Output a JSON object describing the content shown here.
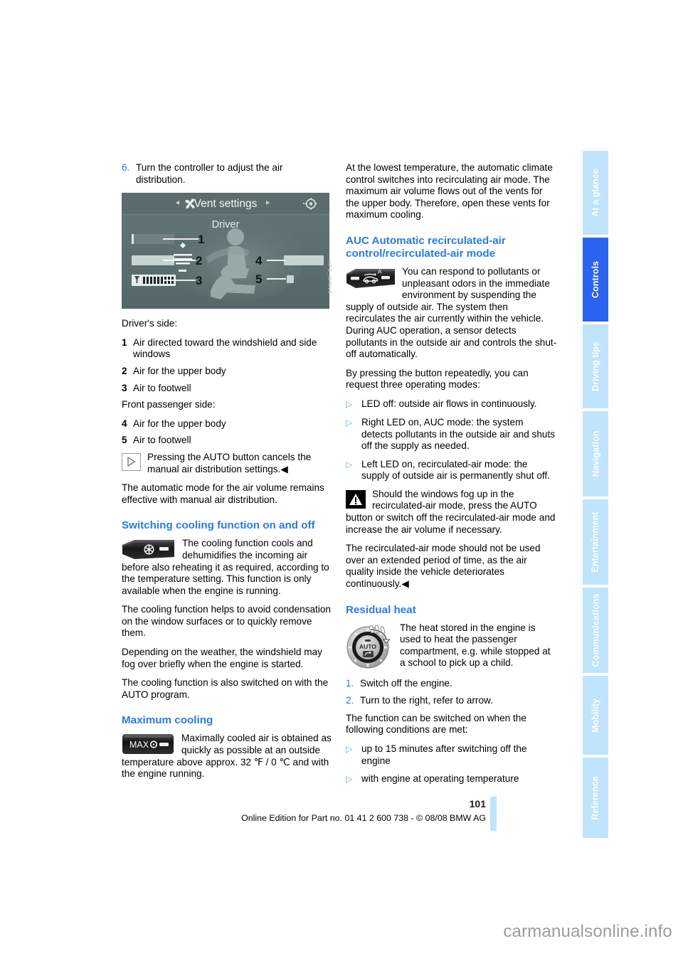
{
  "document": {
    "page_number": "101",
    "edition_line": "Online Edition for Part no. 01 41 2 600 738 - © 08/08 BMW AG",
    "watermark": "carmanualsonline.info"
  },
  "tabs": [
    {
      "label": "At a glance",
      "active": false
    },
    {
      "label": "Controls",
      "active": true
    },
    {
      "label": "Driving tips",
      "active": false
    },
    {
      "label": "Navigation",
      "active": false
    },
    {
      "label": "Entertainment",
      "active": false
    },
    {
      "label": "Communications",
      "active": false
    },
    {
      "label": "Mobility",
      "active": false
    },
    {
      "label": "Reference",
      "active": false
    }
  ],
  "colors": {
    "heading_blue": "#2a7ae4",
    "tab_inactive": "#bfe4fb",
    "tab_active": "#2a63ee",
    "bullet_blue": "#6ba8f0"
  },
  "left_column": {
    "step6": {
      "num": "6.",
      "text": "Turn the controller to adjust the air distribution."
    },
    "figure": {
      "header_title": "Vent settings",
      "subtitle": "Driver",
      "left_arrow": "◂",
      "right_arrow": "▸",
      "fan_icon": "fan-icon",
      "gear_icon": "settings-icon",
      "callout_labels": [
        "1",
        "2",
        "3",
        "4",
        "5"
      ],
      "code": "HFD_IDRIVE"
    },
    "drivers_side_label": "Driver's side:",
    "drivers_side_items": [
      {
        "num": "1",
        "text": "Air directed toward the windshield and side windows"
      },
      {
        "num": "2",
        "text": "Air for the upper body"
      },
      {
        "num": "3",
        "text": "Air to footwell"
      }
    ],
    "passenger_side_label": "Front passenger side:",
    "passenger_side_items": [
      {
        "num": "4",
        "text": "Air for the upper body"
      },
      {
        "num": "5",
        "text": "Air to footwell"
      }
    ],
    "note": "Pressing the AUTO button cancels the manual air distribution settings.◀",
    "auto_mode_para": "The automatic mode for the air volume remains effective with manual air distribution.",
    "cooling_heading": "Switching cooling function on and off",
    "cooling_para1": "The cooling function cools and dehumidifies the incoming air before also reheating it as required, according to the temperature setting. This function is only available when the engine is running.",
    "cooling_para2": "The cooling function helps to avoid condensation on the window surfaces or to quickly remove them.",
    "cooling_para3": "Depending on the weather, the windshield may fog over briefly when the engine is started.",
    "cooling_para4": "The cooling function is also switched on with the AUTO program.",
    "max_heading": "Maximum cooling",
    "max_button_label": "MAX",
    "max_para": "Maximally cooled air is obtained as quickly as possible at an outside temperature above approx. 32 ℉ / 0 ℃ and with the engine running."
  },
  "right_column": {
    "lowest_temp_para": "At the lowest temperature, the automatic climate control switches into recirculating air mode. The maximum air volume flows out of the vents for the upper body. Therefore, open these vents for maximum cooling.",
    "auc_heading": "AUC Automatic recirculated-air control/recirculated-air mode",
    "auc_button_letter": "A",
    "auc_para1": "You can respond to pollutants or unpleasant odors in the immediate environment by suspending the supply of outside air. The system then recirculates the air currently within the vehicle. During AUC operation, a sensor detects pollutants in the outside air and controls the shut-off automatically.",
    "auc_para2": "By pressing the button repeatedly, you can request three operating modes:",
    "auc_modes": [
      "LED off: outside air flows in continuously.",
      "Right LED on, AUC mode: the system detects pollutants in the outside air and shuts off the supply as needed.",
      "Left LED on, recirculated-air mode: the supply of outside air is permanently shut off."
    ],
    "warning": "Should the windows fog up in the recirculated-air mode, press the AUTO button or switch off the recirculated-air mode and increase the air volume if necessary.",
    "warning2": "The recirculated-air mode should not be used over an extended period of time, as the air quality inside the vehicle deteriorates continuously.◀",
    "residual_heading": "Residual heat",
    "knob_label": "AUTO",
    "residual_para": "The heat stored in the engine is used to heat the passenger compartment, e.g. while stopped at a school to pick up a child.",
    "residual_steps": [
      {
        "num": "1.",
        "text": "Switch off the engine."
      },
      {
        "num": "2.",
        "text": "Turn to the right, refer to arrow."
      }
    ],
    "conditions_intro": "The function can be switched on when the following conditions are met:",
    "conditions": [
      "up to 15 minutes after switching off the engine",
      "with engine at operating temperature"
    ]
  }
}
